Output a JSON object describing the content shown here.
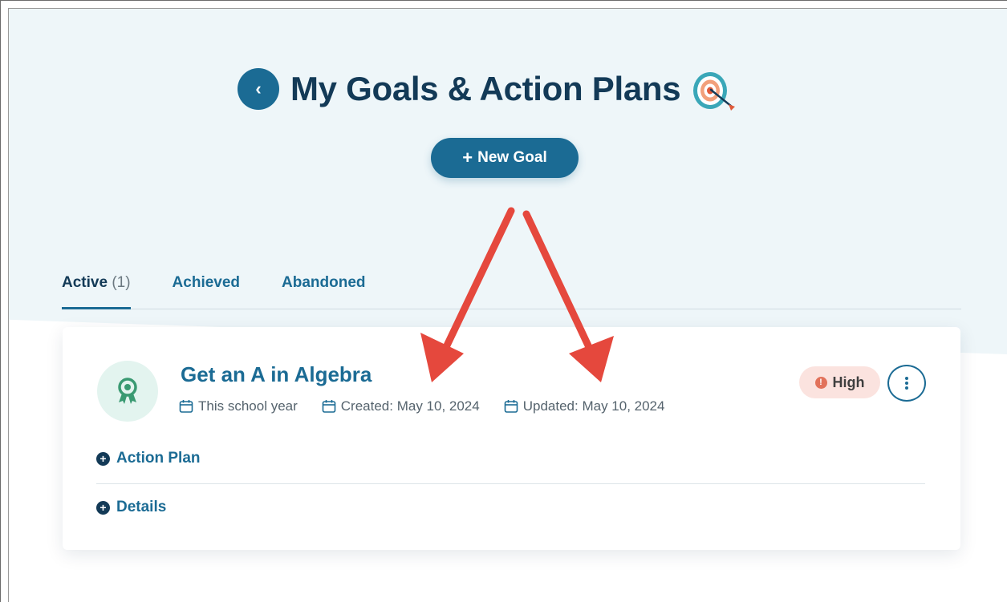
{
  "page": {
    "title": "My Goals & Action Plans",
    "back_label": "‹",
    "new_goal_label": "New Goal",
    "icons": {
      "back": "chevron-left-icon",
      "title": "target-icon",
      "new_goal": "plus-icon"
    }
  },
  "tabs": [
    {
      "label": "Active",
      "count": "(1)",
      "active": true
    },
    {
      "label": "Achieved",
      "count": ""
    },
    {
      "label": "Abandoned",
      "count": ""
    }
  ],
  "goal": {
    "title": "Get an A in Algebra",
    "timeframe": "This school year",
    "created": "Created: May 10, 2024",
    "updated": "Updated: May 10, 2024",
    "priority": "High",
    "priority_icon": "!",
    "action_plan_label": "Action Plan",
    "details_label": "Details",
    "icons": {
      "avatar": "award-ribbon-icon",
      "calendar": "calendar-icon",
      "menu": "kebab-menu-icon"
    }
  },
  "colors": {
    "primary": "#1b6b94",
    "title_text": "#133a57",
    "hero_bg": "#eef6f9",
    "priority_bg": "#fbe3df",
    "priority_dot": "#e2725b",
    "annotation_arrow": "#e5483d"
  }
}
